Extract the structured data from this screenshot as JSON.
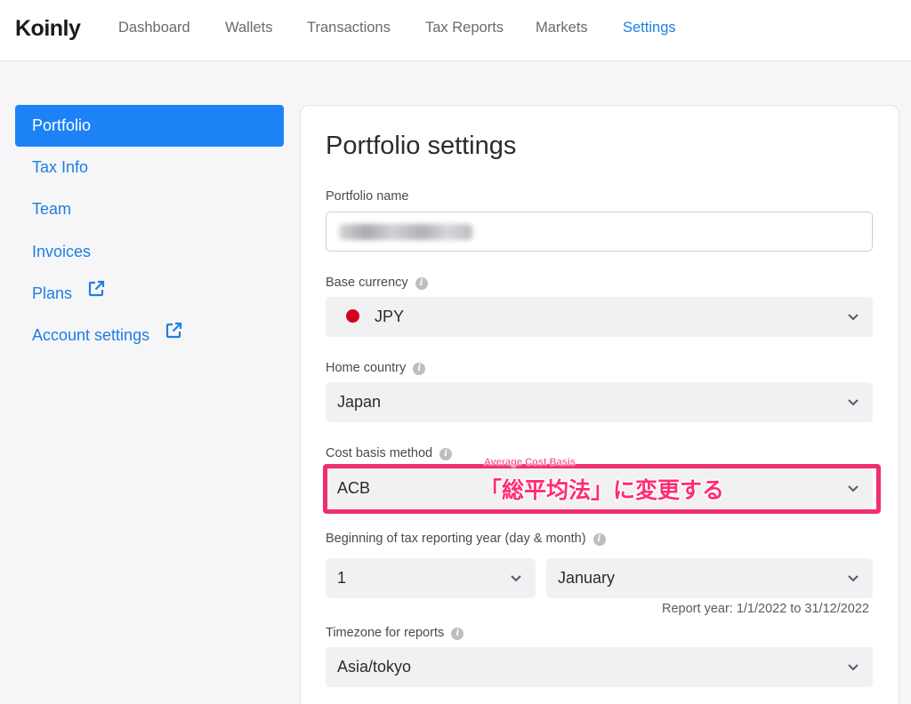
{
  "app": {
    "logo": "Koinly"
  },
  "nav": {
    "items": [
      {
        "label": "Dashboard"
      },
      {
        "label": "Wallets"
      },
      {
        "label": "Transactions"
      },
      {
        "label": "Tax Reports"
      },
      {
        "label": "Markets"
      },
      {
        "label": "Settings",
        "active": true
      }
    ]
  },
  "sidebar": {
    "items": [
      {
        "label": "Portfolio",
        "active": true
      },
      {
        "label": "Tax Info"
      },
      {
        "label": "Team"
      },
      {
        "label": "Invoices"
      },
      {
        "label": "Plans",
        "icon": "external-link-icon"
      },
      {
        "label": "Account settings",
        "icon": "external-link-icon"
      }
    ]
  },
  "settings": {
    "title": "Portfolio settings",
    "portfolio_name": {
      "label": "Portfolio name",
      "value": ""
    },
    "base_currency": {
      "label": "Base currency",
      "value": "JPY",
      "flag_color": "#d6001c"
    },
    "home_country": {
      "label": "Home country",
      "value": "Japan"
    },
    "cost_basis": {
      "label": "Cost basis method",
      "value": "ACB"
    },
    "tax_year": {
      "label": "Beginning of tax reporting year (day & month)",
      "day": "1",
      "month": "January",
      "report_year": "Report year: 1/1/2022 to 31/12/2022"
    },
    "timezone": {
      "label": "Timezone for reports",
      "value": "Asia/tokyo"
    }
  },
  "annotation": {
    "small": "Average Cost Basis",
    "big": "「総平均法」に変更する",
    "color": "#ef2f6f"
  },
  "colors": {
    "accent": "#1e82f7",
    "link": "#1e7fe0"
  }
}
